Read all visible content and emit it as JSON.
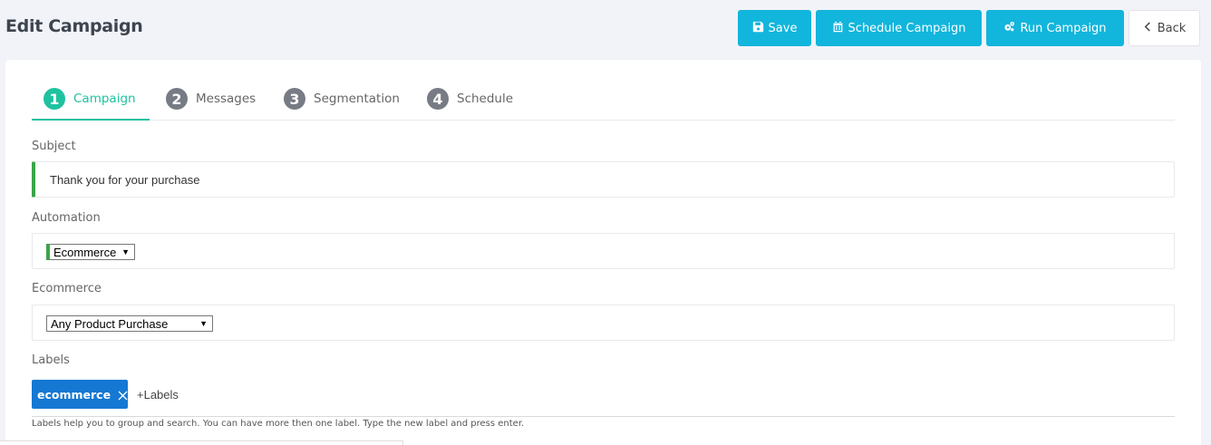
{
  "page": {
    "title": "Edit Campaign"
  },
  "toolbar": {
    "save_label": "Save",
    "schedule_label": "Schedule Campaign",
    "run_label": "Run Campaign",
    "back_label": "Back"
  },
  "steps": [
    {
      "num": "1",
      "label": "Campaign",
      "active": true
    },
    {
      "num": "2",
      "label": "Messages",
      "active": false
    },
    {
      "num": "3",
      "label": "Segmentation",
      "active": false
    },
    {
      "num": "4",
      "label": "Schedule",
      "active": false
    }
  ],
  "form": {
    "subject": {
      "label": "Subject",
      "value": "Thank you for your purchase"
    },
    "automation": {
      "label": "Automation",
      "selected": "Ecommerce"
    },
    "ecommerce": {
      "label": "Ecommerce",
      "selected": "Any Product Purchase"
    },
    "labels": {
      "label": "Labels",
      "tags": [
        "ecommerce"
      ],
      "add_text": "+Labels",
      "help": "Labels help you to group and search. You can have more then one label. Type the new label and press enter."
    }
  },
  "colors": {
    "accent": "#12b5dc",
    "step_active": "#1fc2a0",
    "tag": "#1578d3",
    "valid_bar": "#3aa548"
  }
}
